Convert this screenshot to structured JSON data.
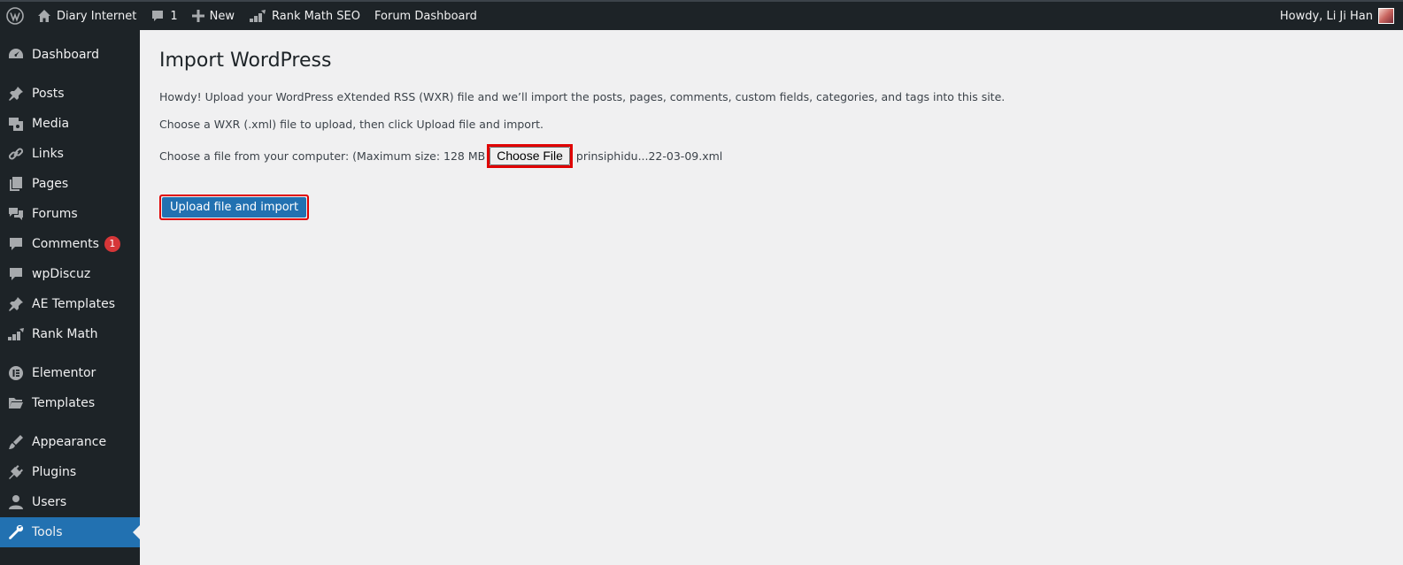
{
  "admin_bar": {
    "site_name": "Diary Internet",
    "comments_count": "1",
    "new_label": "New",
    "rank_math_label": "Rank Math SEO",
    "forum_dashboard_label": "Forum Dashboard",
    "greeting": "Howdy, Li Ji Han"
  },
  "sidebar": {
    "items": [
      {
        "label": "Dashboard",
        "icon": "dashboard-icon"
      },
      {
        "label": "Posts",
        "icon": "pin-icon"
      },
      {
        "label": "Media",
        "icon": "media-icon"
      },
      {
        "label": "Links",
        "icon": "link-icon"
      },
      {
        "label": "Pages",
        "icon": "pages-icon"
      },
      {
        "label": "Forums",
        "icon": "forums-icon"
      },
      {
        "label": "Comments",
        "icon": "comment-icon",
        "badge": "1"
      },
      {
        "label": "wpDiscuz",
        "icon": "comment-icon"
      },
      {
        "label": "AE Templates",
        "icon": "pin-icon"
      },
      {
        "label": "Rank Math",
        "icon": "chart-icon"
      },
      {
        "label": "Elementor",
        "icon": "elementor-icon"
      },
      {
        "label": "Templates",
        "icon": "folder-icon"
      },
      {
        "label": "Appearance",
        "icon": "brush-icon"
      },
      {
        "label": "Plugins",
        "icon": "plug-icon"
      },
      {
        "label": "Users",
        "icon": "user-icon"
      },
      {
        "label": "Tools",
        "icon": "wrench-icon",
        "current": true
      }
    ]
  },
  "main": {
    "title": "Import WordPress",
    "intro": "Howdy! Upload your WordPress eXtended RSS (WXR) file and we’ll import the posts, pages, comments, custom fields, categories, and tags into this site.",
    "instruction": "Choose a WXR (.xml) file to upload, then click Upload file and import.",
    "file_label": "Choose a file from your computer: (Maximum size: 128 MB",
    "choose_file_label": "Choose File",
    "file_name": "prinsiphidu...22-03-09.xml",
    "upload_button_label": "Upload file and import"
  },
  "colors": {
    "admin_bg": "#1d2327",
    "accent": "#2271b1",
    "highlight_border": "#e00000",
    "badge": "#d63638"
  }
}
